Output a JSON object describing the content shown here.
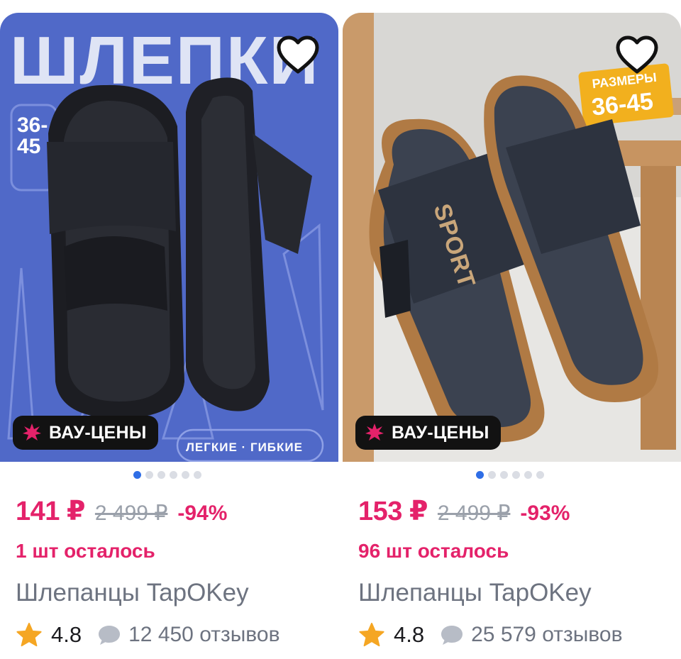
{
  "products": [
    {
      "badge": "ВАУ-ЦЕНЫ",
      "price": "141 ₽",
      "old_price": "2 499 ₽",
      "discount": "-94%",
      "stock": "1 шт осталось",
      "title": "Шлепанцы TapOKey",
      "rating": "4.8",
      "reviews": "12 450 отзывов",
      "image_text": {
        "headline": "ШЛЕПКИ",
        "sizes_top": "36-",
        "sizes_bottom": "45",
        "features": "ЛЕГКИЕ · ГИБКИЕ"
      },
      "carousel": {
        "total": 6,
        "active": 1
      }
    },
    {
      "badge": "ВАУ-ЦЕНЫ",
      "price": "153 ₽",
      "old_price": "2 499 ₽",
      "discount": "-93%",
      "stock": "96 шт осталось",
      "title": "Шлепанцы TapOKey",
      "rating": "4.8",
      "reviews": "25 579 отзывов",
      "image_text": {
        "sizes_label": "РАЗМЕРЫ",
        "sizes": "36-45",
        "strap": "SPORT"
      },
      "carousel": {
        "total": 6,
        "active": 1
      }
    }
  ],
  "icons": {
    "favorite": "heart-outline-icon",
    "badge": "burst-icon",
    "rating": "star-icon",
    "reviews": "chat-bubble-icon"
  },
  "colors": {
    "price": "#e4226a",
    "dot_active": "#2f6ee6",
    "star": "#f5a623",
    "badge_bg": "#121212"
  }
}
